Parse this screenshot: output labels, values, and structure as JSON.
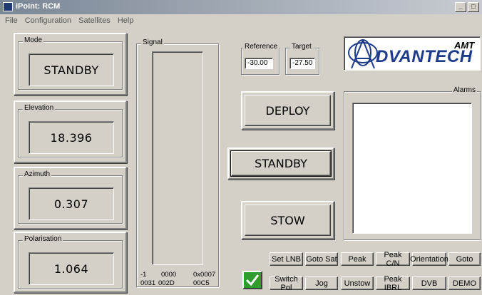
{
  "window": {
    "title": "iPoint: RCM"
  },
  "menu": [
    "File",
    "Configuration",
    "Satellites",
    "Help"
  ],
  "mode": {
    "label": "Mode",
    "value": "STANDBY"
  },
  "elevation": {
    "label": "Elevation",
    "value": "18.396"
  },
  "azimuth": {
    "label": "Azimuth",
    "value": "0.307"
  },
  "polarisation": {
    "label": "Polarisation",
    "value": "1.064"
  },
  "signal": {
    "label": "Signal",
    "readout": {
      "row1": [
        "-1",
        "0000",
        "0x0007"
      ],
      "row2": [
        "0031",
        "002D",
        "00C5"
      ]
    }
  },
  "reference": {
    "label": "Reference",
    "value": "-30.00"
  },
  "target": {
    "label": "Target",
    "value": "-27.50"
  },
  "logo": {
    "brand": "DVANTECH",
    "sup": "AMT",
    "initial": "A"
  },
  "actions": {
    "deploy": "DEPLOY",
    "standby": "STANDBY",
    "stow": "STOW"
  },
  "alarms": {
    "label": "Alarms"
  },
  "toolbar": {
    "row1": [
      "Set LNB",
      "Goto Sat",
      "Peak",
      "Peak C/N",
      "Orientation",
      "Goto"
    ],
    "row2": [
      "Switch Pol",
      "Jog",
      "Unstow",
      "Peak IBRL",
      "DVB",
      "DEMO"
    ]
  },
  "colors": {
    "status_ok": "#2e9c2e",
    "logo_blue": "#1d3b8a"
  }
}
